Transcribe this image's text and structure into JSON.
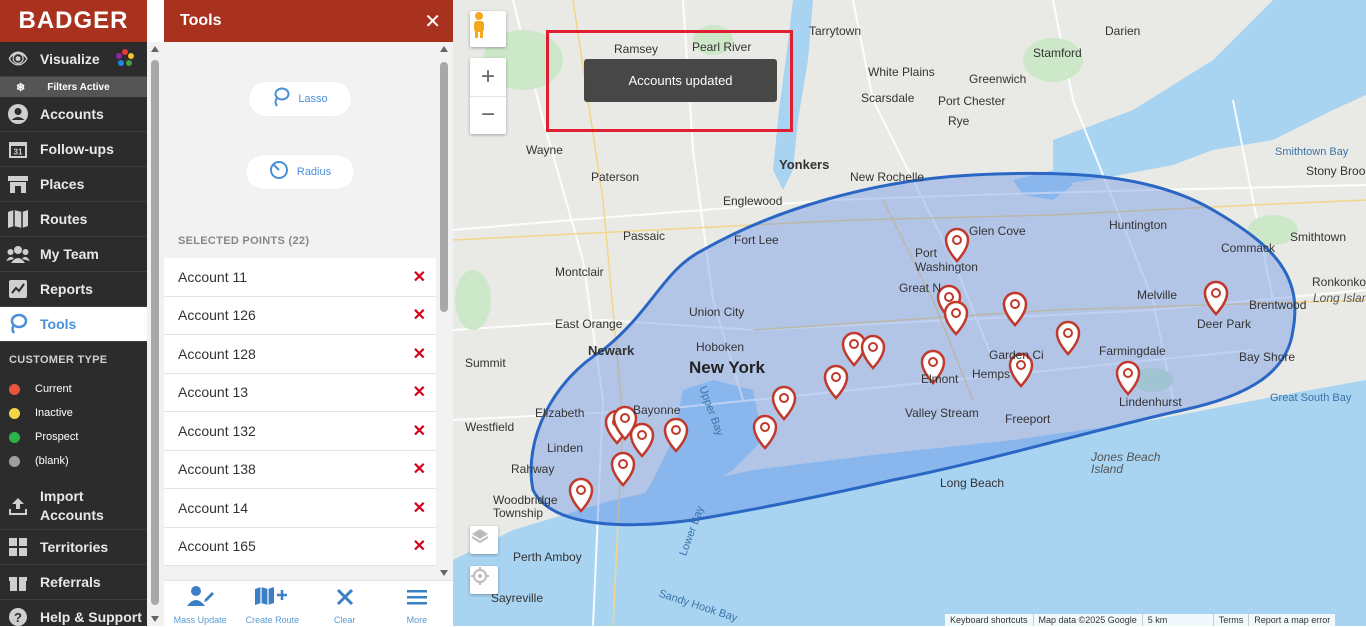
{
  "app": {
    "logo": "BADGER"
  },
  "nav": {
    "visualize": "Visualize",
    "filters_active": "Filters Active",
    "accounts": "Accounts",
    "followups": "Follow-ups",
    "places": "Places",
    "routes": "Routes",
    "my_team": "My Team",
    "reports": "Reports",
    "tools": "Tools",
    "customer_type_header": "CUSTOMER TYPE",
    "legend": [
      {
        "label": "Current",
        "color": "#e8553e"
      },
      {
        "label": "Inactive",
        "color": "#f2d64a"
      },
      {
        "label": "Prospect",
        "color": "#2bb24c"
      },
      {
        "label": "(blank)",
        "color": "#9e9e9e"
      }
    ],
    "import_accounts": "Import Accounts",
    "territories": "Territories",
    "referrals": "Referrals",
    "help_support": "Help & Support"
  },
  "tools_panel": {
    "title": "Tools",
    "close": "✕",
    "lasso": "Lasso",
    "radius": "Radius",
    "selected_header": "SELECTED POINTS (22)",
    "selected": [
      "Account 11",
      "Account 126",
      "Account 128",
      "Account 13",
      "Account 132",
      "Account 138",
      "Account 14",
      "Account 165"
    ],
    "remove_glyph": "✕",
    "bottom": {
      "mass_update": "Mass Update",
      "create_route": "Create Route",
      "clear": "Clear",
      "more": "More"
    }
  },
  "map": {
    "toast": "Accounts updated",
    "zoom_in": "+",
    "zoom_out": "−",
    "labels": {
      "new_york": "New York",
      "yonkers": "Yonkers",
      "newark": "Newark",
      "paterson": "Paterson",
      "passaic": "Passaic",
      "montclair": "Montclair",
      "east_orange": "East Orange",
      "summit": "Summit",
      "westfield": "Westfield",
      "elizabeth": "Elizabeth",
      "bayonne": "Bayonne",
      "linden": "Linden",
      "rahway": "Rahway",
      "woodbridge": "Woodbridge Township",
      "perth_amboy": "Perth Amboy",
      "sayreville": "Sayreville",
      "ramsey": "Ramsey",
      "pearl_river": "Pearl River",
      "tarrytown": "Tarrytown",
      "white_plains": "White Plains",
      "scarsdale": "Scarsdale",
      "stamford": "Stamford",
      "darien": "Darien",
      "greenwich": "Greenwich",
      "port_chester": "Port Chester",
      "rye": "Rye",
      "wayne": "Wayne",
      "englewood": "Englewood",
      "fort_lee": "Fort Lee",
      "union_city": "Union City",
      "hoboken": "Hoboken",
      "new_rochelle": "New Rochelle",
      "glen_cove": "Glen Cove",
      "port_washington": "Port Washington",
      "great_neck": "Great N",
      "huntington": "Huntington",
      "commack": "Commack",
      "smithtown": "Smithtown",
      "melville": "Melville",
      "deer_park": "Deer Park",
      "brentwood": "Brentwood",
      "farmingdale": "Farmingdale",
      "garden_city": "Garden Ci",
      "hempstead": "Hemps",
      "elmont": "Elmont",
      "valley_stream": "Valley Stream",
      "freeport": "Freeport",
      "lindenhurst": "Lindenhurst",
      "bay_shore": "Bay Shore",
      "long_beach": "Long Beach",
      "jones_beach": "Jones Beach Island",
      "great_south_bay": "Great South Bay",
      "smithtown_bay": "Smithtown Bay",
      "stony_brook": "Stony Brook",
      "ronkonkoma": "Ronkonkoma",
      "long_island": "Long Islan",
      "upper_bay": "Upper Bay",
      "lower_bay": "Lower Bay",
      "sandy_hook": "Sandy Hook Bay"
    },
    "attribution": [
      "Keyboard shortcuts",
      "Map data ©2025 Google",
      "5 km",
      "Terms",
      "Report a map error"
    ]
  }
}
